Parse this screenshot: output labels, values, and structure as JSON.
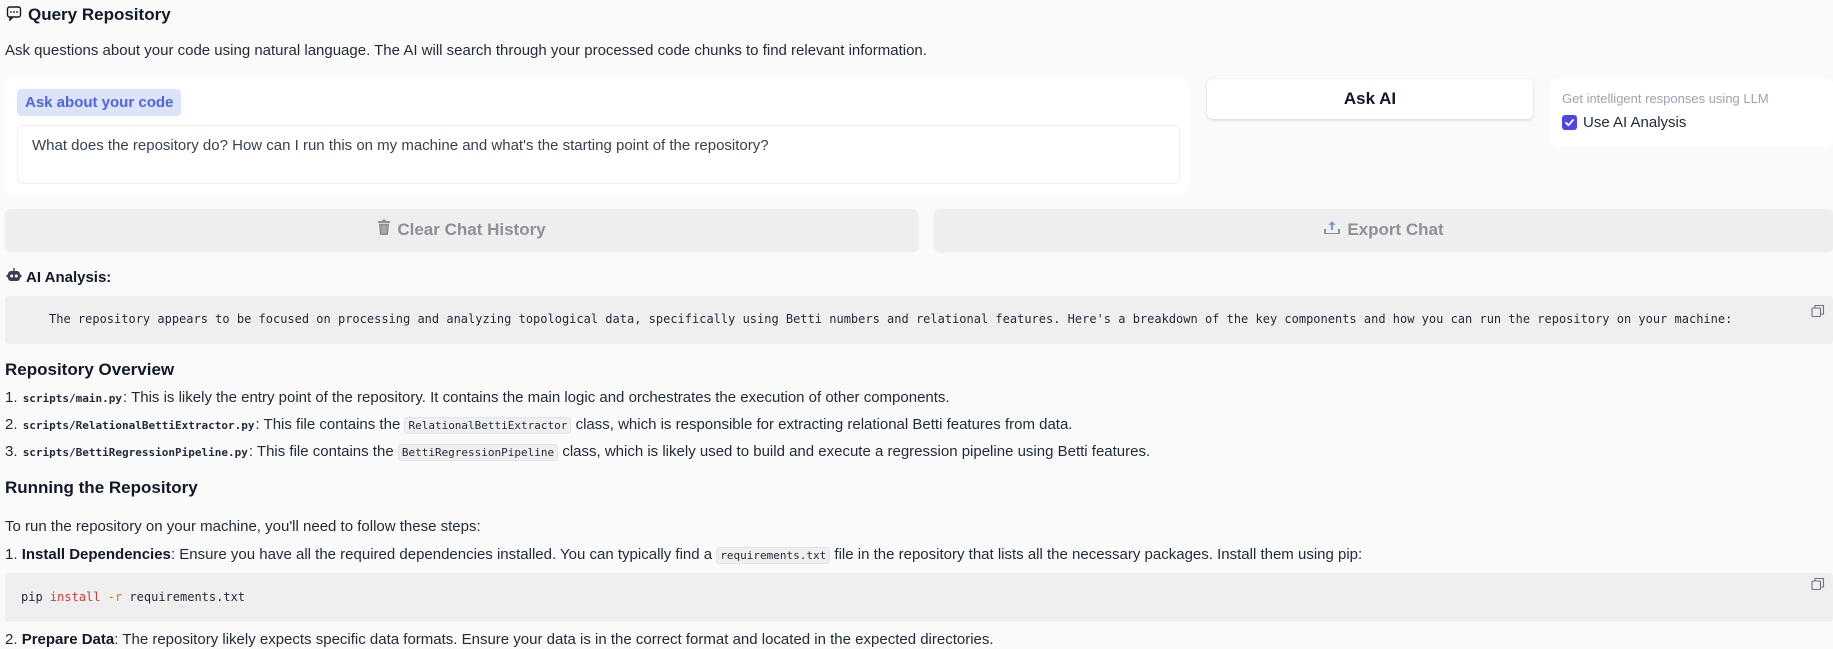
{
  "header": {
    "title": "Query Repository",
    "description": "Ask questions about your code using natural language. The AI will search through your processed code chunks to find relevant information."
  },
  "query": {
    "label": "Ask about your code",
    "value": "What does the repository do? How can I run this on my machine and what's the starting point of the repository?"
  },
  "ask_button": "Ask AI",
  "ai_option": {
    "hint": "Get intelligent responses using LLM",
    "checkbox_label": "Use AI Analysis",
    "checked": true
  },
  "actions": {
    "clear": "Clear Chat History",
    "export": "Export Chat"
  },
  "analysis": {
    "heading": "AI Analysis:",
    "intro": "The repository appears to be focused on processing and analyzing topological data, specifically using Betti numbers and relational features. Here's a breakdown of the key components and how you can run the repository on your machine:",
    "overview_heading": "Repository Overview",
    "overview_items": [
      {
        "num": "1.",
        "file": "scripts/main.py",
        "pre": ": This is likely the entry point of the repository. It contains the main logic and orchestrates the execution of other components.",
        "cls": "",
        "post": ""
      },
      {
        "num": "2.",
        "file": "scripts/RelationalBettiExtractor.py",
        "pre": ": This file contains the ",
        "cls": "RelationalBettiExtractor",
        "post": " class, which is responsible for extracting relational Betti features from data."
      },
      {
        "num": "3.",
        "file": "scripts/BettiRegressionPipeline.py",
        "pre": ": This file contains the ",
        "cls": "BettiRegressionPipeline",
        "post": " class, which is likely used to build and execute a regression pipeline using Betti features."
      }
    ],
    "running_heading": "Running the Repository",
    "running_intro": "To run the repository on your machine, you'll need to follow these steps:",
    "step1": {
      "num": "1.",
      "title": "Install Dependencies",
      "pre": ": Ensure you have all the required dependencies installed. You can typically find a ",
      "code": "requirements.txt",
      "post": " file in the repository that lists all the necessary packages. Install them using pip:"
    },
    "pip_cmd": {
      "cmd": "pip",
      "sub": "install",
      "flag": "-r",
      "arg": "requirements.txt"
    },
    "step2": {
      "num": "2.",
      "title": "Prepare Data",
      "text": ": The repository likely expects specific data formats. Ensure your data is in the correct format and located in the expected directories."
    }
  },
  "colors": {
    "accent": "#4f46e5",
    "label_bg": "#dbe4fb",
    "label_fg": "#4f63e6"
  }
}
